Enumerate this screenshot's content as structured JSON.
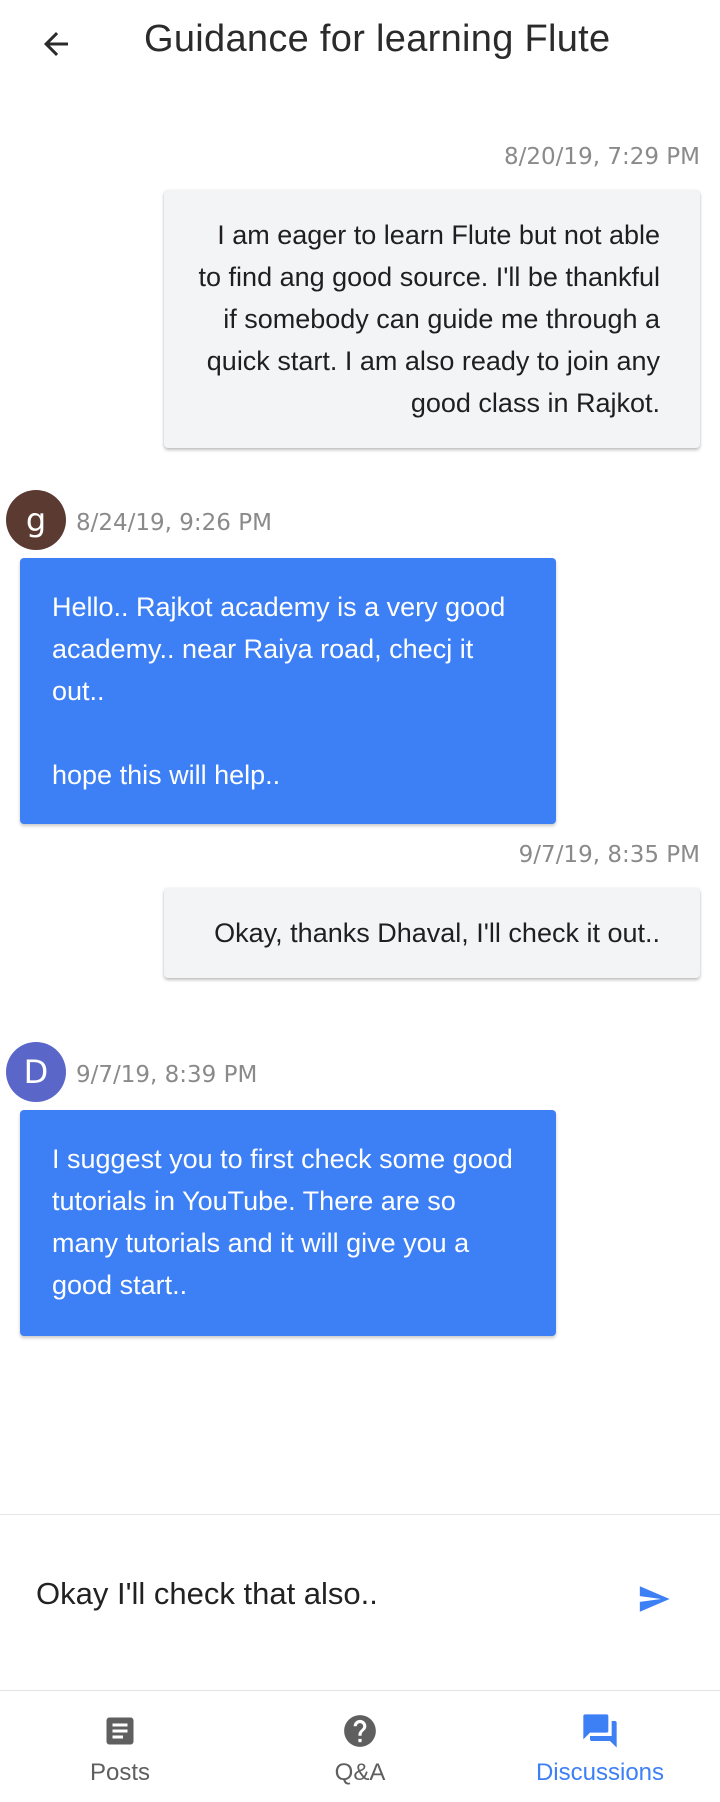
{
  "header": {
    "title": "Guidance for learning Flute",
    "back_icon": "arrow-left-icon"
  },
  "messages": [
    {
      "direction": "outgoing",
      "timestamp": "8/20/19, 7:29 PM",
      "text": "I am eager to learn Flute but not able to find ang good source. I'll be thankful if somebody can guide me through a quick start. I am also ready to join any good class in Rajkot."
    },
    {
      "direction": "incoming",
      "avatar": {
        "letter": "g",
        "color": "#5b3a32"
      },
      "timestamp": "8/24/19, 9:26 PM",
      "text": " Hello.. Rajkot academy is a very good academy.. near Raiya road, checj it out..\n\nhope this will help.."
    },
    {
      "direction": "outgoing",
      "timestamp": "9/7/19, 8:35 PM",
      "text": "Okay, thanks Dhaval, I'll check it out.."
    },
    {
      "direction": "incoming",
      "avatar": {
        "letter": "D",
        "color": "#5a67c8"
      },
      "timestamp": "9/7/19, 8:39 PM",
      "text": " I suggest you to first check some good tutorials in YouTube. There are so many tutorials and it will give you a good start.."
    }
  ],
  "composer": {
    "value": "Okay I'll check that also..",
    "send_icon": "send-icon"
  },
  "bottom_nav": {
    "items": [
      {
        "label": "Posts",
        "icon": "article-icon",
        "active": false
      },
      {
        "label": "Q&A",
        "icon": "help-circle-icon",
        "active": false
      },
      {
        "label": "Discussions",
        "icon": "forum-icon",
        "active": true
      }
    ]
  },
  "colors": {
    "accent": "#3d7ff5",
    "outgoing_bubble": "#f3f4f6",
    "timestamp": "#8a8a8a"
  }
}
